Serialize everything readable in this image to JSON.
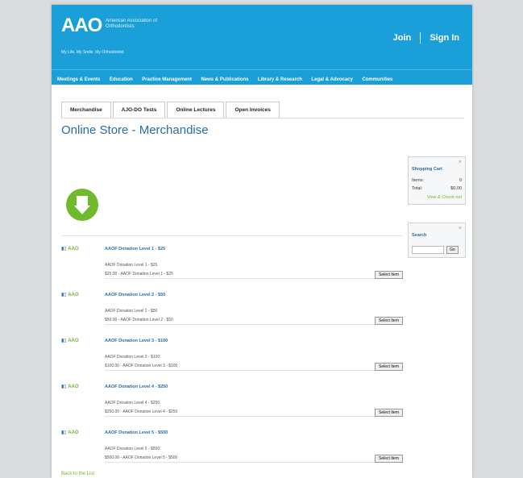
{
  "header": {
    "logo_mark": "AAO",
    "logo_text": "American Association of Orthodontists",
    "tagline": "My Life. My Smile. My Orthodontist.",
    "join_label": "Join",
    "signin_label": "Sign In"
  },
  "nav": {
    "items": [
      "Meetings & Events",
      "Education",
      "Practice Management",
      "News & Publications",
      "Library & Research",
      "Legal & Advocacy",
      "Communities"
    ]
  },
  "tabs": [
    "Merchandise",
    "AJO-DO Tests",
    "Online Lectures",
    "Open Invoices"
  ],
  "page_title": "Online Store - Merchandise",
  "cart": {
    "title": "Shopping Cart",
    "items_label": "Items:",
    "items_value": "0",
    "total_label": "Total:",
    "total_value": "$0.00",
    "link": "View & Check out"
  },
  "search": {
    "title": "Search",
    "button": "Go"
  },
  "products": [
    {
      "thumb": "AAO",
      "name": "AAOF Donation Level 1 - $25",
      "desc": "AAOF Donation Level 1 - $25",
      "price": "$25.00 - AAOF Donation Level 1 - $25",
      "select": "Select Item"
    },
    {
      "thumb": "AAO",
      "name": "AAOF Donation Level 2 - $50",
      "desc": "AAOF Donation Level 2 - $50",
      "price": "$50.00 - AAOF Donation Level 2 - $50",
      "select": "Select Item"
    },
    {
      "thumb": "AAO",
      "name": "AAOF Donation Level 3 - $100",
      "desc": "AAOF Donation Level 3 - $100",
      "price": "$100.00 - AAOF Donation Level 3 - $100",
      "select": "Select Item"
    },
    {
      "thumb": "AAO",
      "name": "AAOF Donation Level 4 - $250",
      "desc": "AAOF Donation Level 4 - $250",
      "price": "$250.00 - AAOF Donation Level 4 - $250",
      "select": "Select Item"
    },
    {
      "thumb": "AAO",
      "name": "AAOF Donation Level 5 - $500",
      "desc": "AAOF Donation Level 5 - $500",
      "price": "$500.00 - AAOF Donation Level 5 - $500",
      "select": "Select Item"
    }
  ],
  "back_link": "Back to the List"
}
